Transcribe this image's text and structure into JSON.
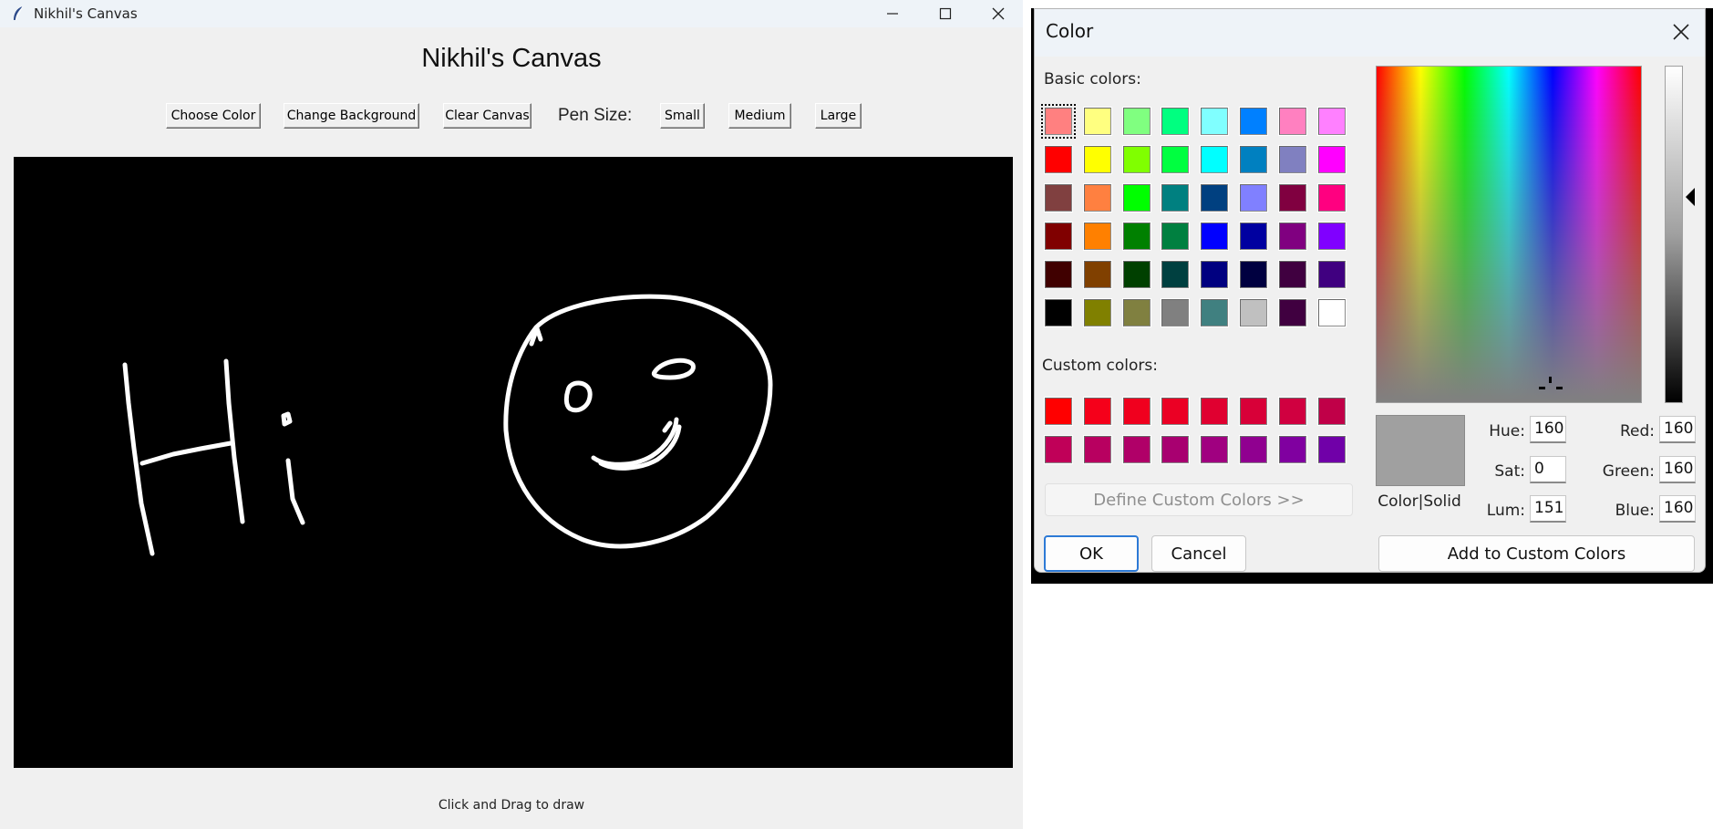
{
  "app": {
    "window_title": "Nikhil's Canvas",
    "heading": "Nikhil's Canvas",
    "toolbar": {
      "choose_color": "Choose Color",
      "change_background": "Change Background",
      "clear_canvas": "Clear Canvas",
      "pen_size_label": "Pen Size:",
      "small": "Small",
      "medium": "Medium",
      "large": "Large"
    },
    "canvas": {
      "background": "#000000",
      "stroke_color": "#ffffff"
    },
    "status": "Click and Drag to draw"
  },
  "color_dialog": {
    "title": "Color",
    "basic_colors_label": "Basic colors:",
    "custom_colors_label": "Custom colors:",
    "basic_colors": [
      "#ff8080",
      "#ffff80",
      "#80ff80",
      "#00ff80",
      "#80ffff",
      "#0080ff",
      "#ff80c0",
      "#ff80ff",
      "#ff0000",
      "#ffff00",
      "#80ff00",
      "#00ff40",
      "#00ffff",
      "#0080c0",
      "#8080c0",
      "#ff00ff",
      "#804040",
      "#ff8040",
      "#00ff00",
      "#008080",
      "#004080",
      "#8080ff",
      "#800040",
      "#ff0080",
      "#800000",
      "#ff8000",
      "#008000",
      "#008040",
      "#0000ff",
      "#0000a0",
      "#800080",
      "#8000ff",
      "#400000",
      "#804000",
      "#004000",
      "#004040",
      "#000080",
      "#000040",
      "#400040",
      "#400080",
      "#000000",
      "#808000",
      "#808040",
      "#808080",
      "#408080",
      "#c0c0c0",
      "#400040",
      "#ffffff"
    ],
    "custom_colors": [
      "#ff0000",
      "#f5001a",
      "#f0001e",
      "#eb0024",
      "#e00030",
      "#d80038",
      "#d00040",
      "#c00048",
      "#c00058",
      "#b80060",
      "#b00068",
      "#a80070",
      "#a00080",
      "#900090",
      "#8000a0",
      "#7000a8"
    ],
    "define_custom": "Define Custom Colors >>",
    "ok": "OK",
    "cancel": "Cancel",
    "preview_label": "Color|Solid",
    "preview_color": "#a0a0a0",
    "hue_label": "Hue:",
    "hue": "160",
    "sat_label": "Sat:",
    "sat": "0",
    "lum_label": "Lum:",
    "lum": "151",
    "red_label": "Red:",
    "red": "160",
    "green_label": "Green:",
    "green": "160",
    "blue_label": "Blue:",
    "blue": "160",
    "add_custom": "Add to Custom Colors"
  }
}
